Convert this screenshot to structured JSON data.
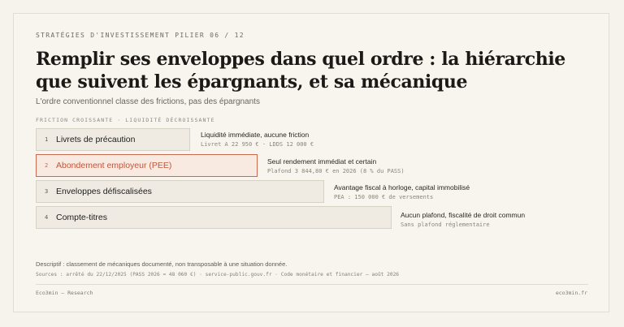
{
  "header": {
    "eyebrow": "STRATÉGIES D'INVESTISSEMENT  PILIER 06 / 12",
    "title": "Remplir ses enveloppes dans quel ordre : la hiérarchie que suivent les épargnants, et sa mécanique",
    "subtitle": "L'ordre conventionnel classe des frictions, pas des épargnants"
  },
  "axis_caption": "FRICTION CROISSANTE · LIQUIDITÉ DÉCROISSANTE",
  "steps": [
    {
      "num": "1",
      "label": "Livrets de précaution",
      "note": "Liquidité immédiate, aucune friction",
      "detail": "Livret A 22 950 € · LDDS 12 000 €"
    },
    {
      "num": "2",
      "label": "Abondement employeur (PEE)",
      "note": "Seul rendement immédiat et certain",
      "detail": "Plafond 3 844,80 € en 2026 (8 % du PASS)",
      "highlight_color": "#c86a50"
    },
    {
      "num": "3",
      "label": "Enveloppes défiscalisées",
      "note": "Avantage fiscal à horloge, capital immobilisé",
      "detail": "PEA : 150 000 € de versements"
    },
    {
      "num": "4",
      "label": "Compte-titres",
      "note": "Aucun plafond, fiscalité de droit commun",
      "detail": "Sans plafond réglementaire"
    }
  ],
  "footer": {
    "description": "Descriptif : classement de mécaniques documenté, non transposable à une situation donnée.",
    "sources": "Sources : arrêté du 22/12/2025 (PASS 2026 = 48 060 €) · service-public.gouv.fr · Code monétaire et financier — août 2026",
    "brand_left": "Eco3min — Research",
    "brand_right": "eco3min.fr"
  }
}
